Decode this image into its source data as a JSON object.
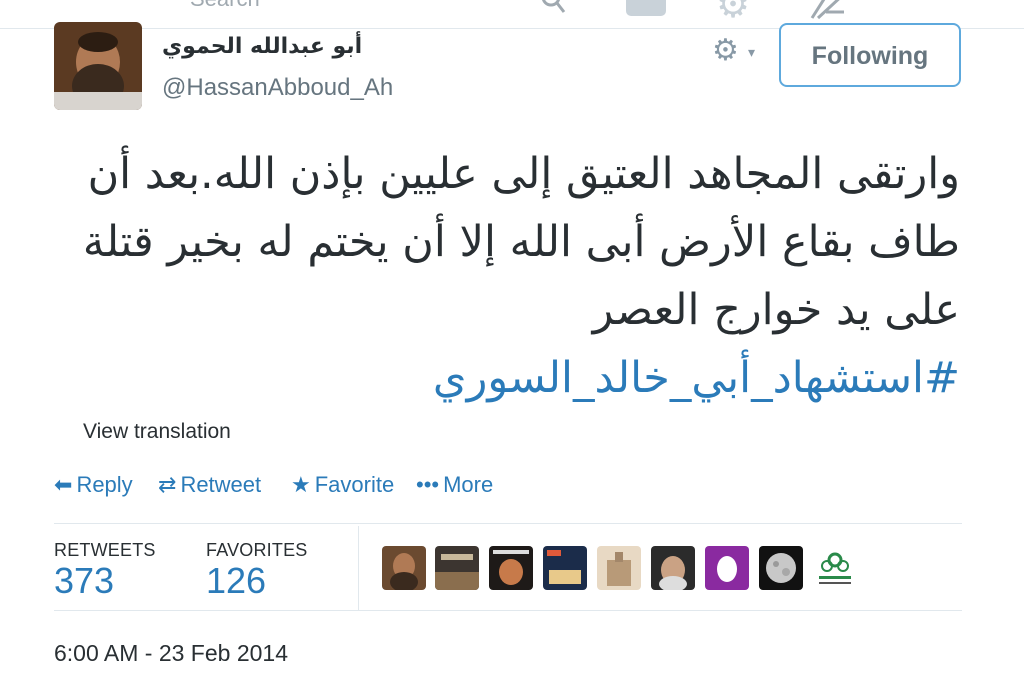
{
  "topbar": {
    "search_placeholder": "Search",
    "icons": [
      "messages-icon",
      "gear-icon",
      "compose-icon"
    ]
  },
  "user": {
    "display_name": "أبو عبدالله الحموي",
    "handle": "@HassanAbboud_Ah"
  },
  "header": {
    "following_label": "Following",
    "menu_icon": "gear-icon"
  },
  "tweet": {
    "lines": [
      "وارتقى المجاهد العتيق إلى عليين بإذن الله.بعد أن",
      "طاف بقاع الأرض أبى الله إلا أن يختم له بخير قتلة",
      "على يد خوارج العصر"
    ],
    "hashtag": "#استشهاد_أبي_خالد_السوري"
  },
  "view_translation": "View translation",
  "actions": {
    "reply": "Reply",
    "retweet": "Retweet",
    "favorite": "Favorite",
    "more": "More"
  },
  "stats": {
    "retweets_label": "RETWEETS",
    "retweets_count": "373",
    "favorites_label": "FAVORITES",
    "favorites_count": "126"
  },
  "timestamp": "6:00 AM - 23 Feb 2014",
  "colors": {
    "link_blue": "#2b7bb9",
    "follow_border": "#5ea9dd",
    "muted_gray": "#66757f",
    "divider": "#e1e8ed"
  }
}
